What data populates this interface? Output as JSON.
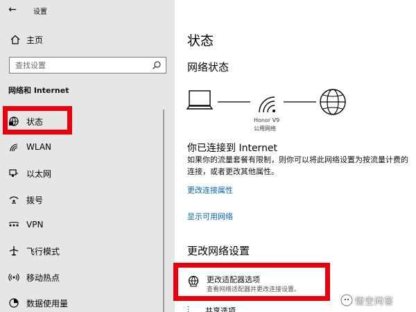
{
  "window": {
    "title": "设置"
  },
  "sidebar": {
    "home_label": "主页",
    "search_placeholder": "查找设置",
    "section_header": "网络和 Internet",
    "items": [
      {
        "label": "状态",
        "icon": "globe-status-icon",
        "selected": true
      },
      {
        "label": "WLAN",
        "icon": "wifi-icon"
      },
      {
        "label": "以太网",
        "icon": "ethernet-icon"
      },
      {
        "label": "拨号",
        "icon": "dialup-icon"
      },
      {
        "label": "VPN",
        "icon": "vpn-icon"
      },
      {
        "label": "飞行模式",
        "icon": "airplane-icon"
      },
      {
        "label": "移动热点",
        "icon": "hotspot-icon"
      },
      {
        "label": "数据使用量",
        "icon": "data-usage-icon"
      }
    ]
  },
  "main": {
    "title": "状态",
    "subtitle": "网络状态",
    "network_name": "Honor V9",
    "network_type": "公用网络",
    "connected_heading": "你已连接到 Internet",
    "description": "如果你的流量套餐有限制，则你可以将此网络设置为按流量计费的连接，或者更改其他属性。",
    "link_change_properties": "更改连接属性",
    "link_show_networks": "显示可用网络",
    "settings_heading": "更改网络设置",
    "adapter_title": "更改适配器选项",
    "adapter_desc": "查看网络适配器并更改连接设置。",
    "sharing_label": "共享选项"
  },
  "colors": {
    "accent": "#0067b8",
    "highlight_red": "#e8000d",
    "sidebar_bg": "#e6e6e6"
  },
  "watermark": {
    "text": "悟空问答"
  }
}
